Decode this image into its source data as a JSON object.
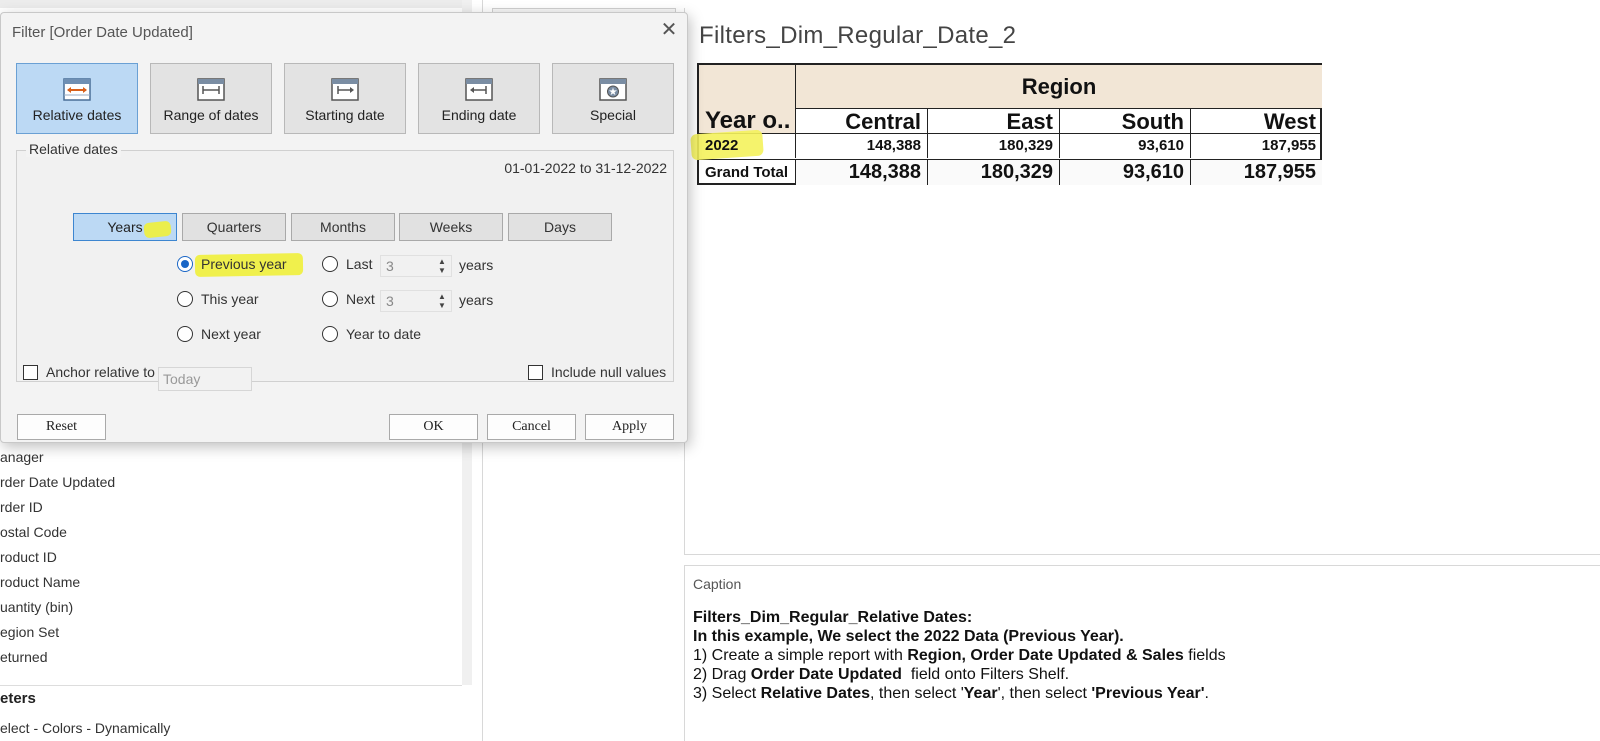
{
  "left_pane": {
    "fields": [
      "anager",
      "rder Date Updated",
      "rder ID",
      "ostal Code",
      "roduct ID",
      "roduct Name",
      "uantity (bin)",
      "egion Set",
      "eturned"
    ],
    "params_title": "eters",
    "param_item": "elect - Colors - Dynamically"
  },
  "worksheet": {
    "title": "Filters_Dim_Regular_Date_2",
    "region_header": "Region",
    "row_header": "Year o..",
    "columns": [
      "Central",
      "East",
      "South",
      "West"
    ],
    "rows": [
      {
        "label": "2022",
        "values": [
          "148,388",
          "180,329",
          "93,610",
          "187,955"
        ]
      },
      {
        "label": "Grand Total",
        "values": [
          "148,388",
          "180,329",
          "93,610",
          "187,955"
        ]
      }
    ]
  },
  "caption": {
    "title": "Caption",
    "line1_bold": "Filters_Dim_Regular_Relative Dates:",
    "line2_bold": "In this example, We select the 2022 Data (Previous Year).",
    "line3_a": "1) Create a simple report with ",
    "line3_b": "Region, Order Date Updated & Sales",
    "line3_c": " fields",
    "line4_a": "2) Drag ",
    "line4_b": "Order Date Updated",
    "line4_c": "  field onto Filters Shelf.",
    "line5_a": "3) Select ",
    "line5_b": "Relative Dates",
    "line5_c": ", then select '",
    "line5_d": "Year",
    "line5_e": "', then select ",
    "line5_f": "'Previous Year'",
    "line5_g": "."
  },
  "dialog": {
    "title": "Filter [Order Date Updated]",
    "close_icon": "close-icon",
    "modes": [
      {
        "label": "Relative dates",
        "icon": "calendar-relative-icon",
        "active": true
      },
      {
        "label": "Range of dates",
        "icon": "calendar-range-icon",
        "active": false
      },
      {
        "label": "Starting date",
        "icon": "calendar-start-icon",
        "active": false
      },
      {
        "label": "Ending date",
        "icon": "calendar-end-icon",
        "active": false
      },
      {
        "label": "Special",
        "icon": "calendar-special-icon",
        "active": false
      }
    ],
    "group_label": "Relative dates",
    "date_range": "01-01-2022 to 31-12-2022",
    "units": [
      "Years",
      "Quarters",
      "Months",
      "Weeks",
      "Days"
    ],
    "selected_unit": "Years",
    "options": {
      "previous": "Previous year",
      "this": "This year",
      "next": "Next year",
      "last": "Last",
      "next_n": "Next",
      "to_date": "Year to date",
      "last_value": "3",
      "next_value": "3",
      "unit_word": "years"
    },
    "selected_option": "Previous year",
    "anchor_label": "Anchor relative to",
    "anchor_placeholder": "Today",
    "include_null": "Include null values",
    "buttons": {
      "reset": "Reset",
      "ok": "OK",
      "cancel": "Cancel",
      "apply": "Apply"
    }
  },
  "colors": {
    "highlight": "#f0f03a",
    "active_blue": "#bcd9f4",
    "table_header": "#f2e6d6"
  }
}
